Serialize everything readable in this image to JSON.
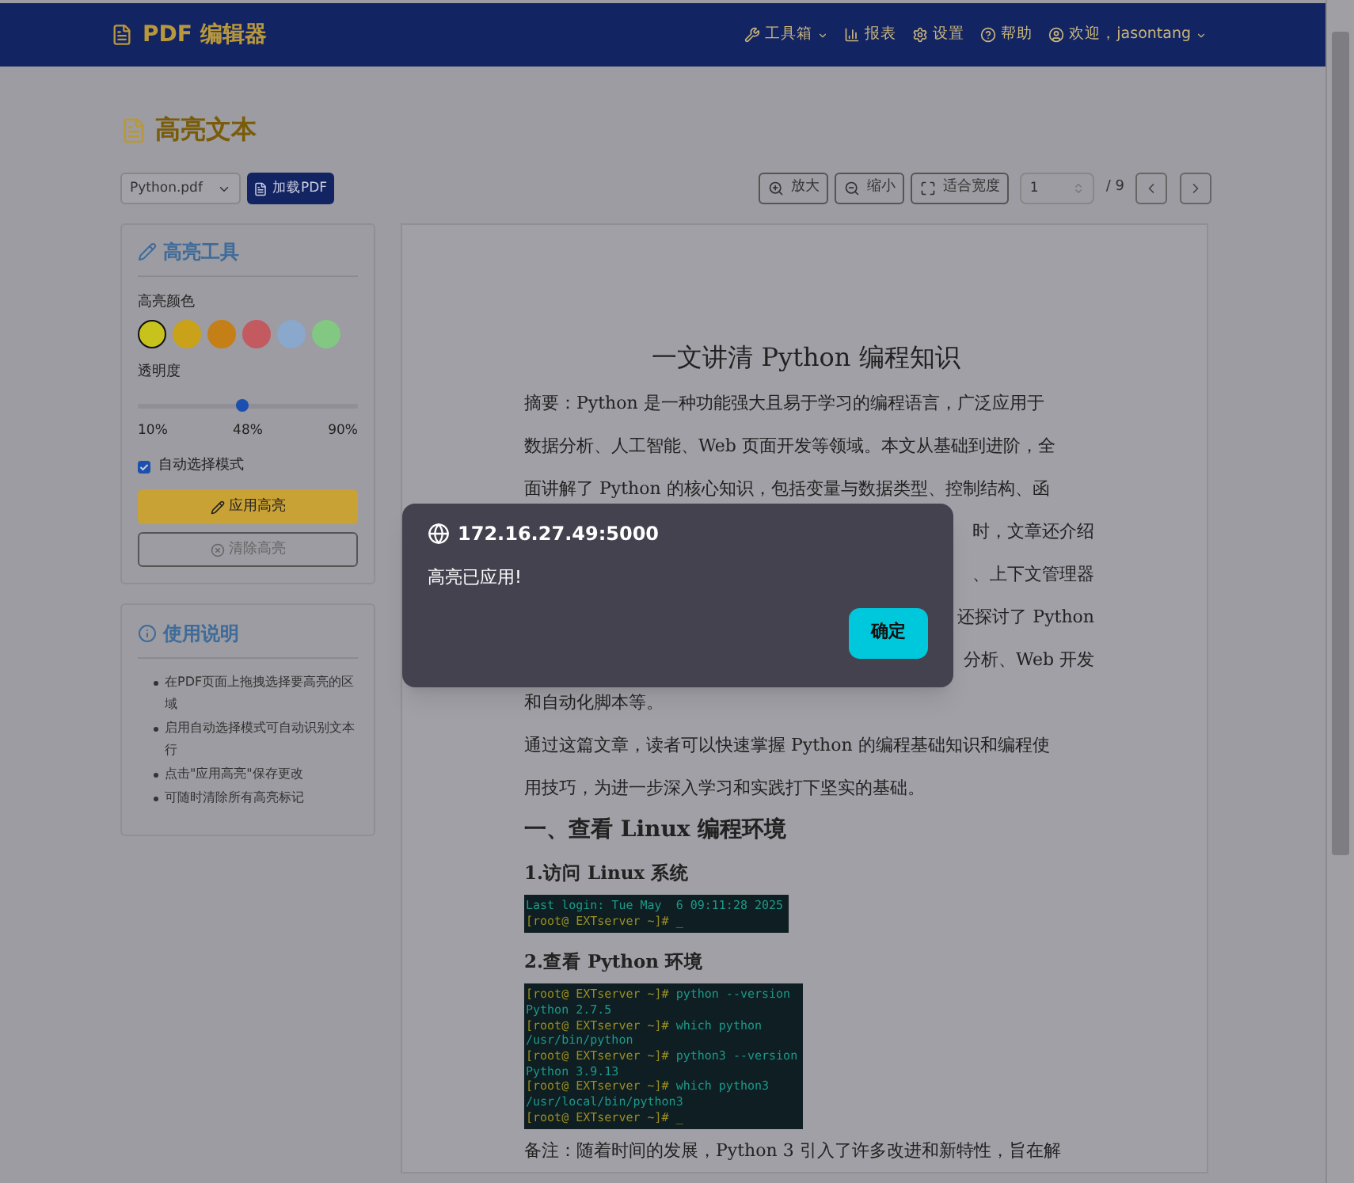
{
  "navbar": {
    "brand": "PDF 编辑器",
    "items": [
      {
        "label": "工具箱",
        "kind": "dropdown"
      },
      {
        "label": "报表",
        "kind": "link"
      },
      {
        "label": "设置",
        "kind": "link"
      },
      {
        "label": "帮助",
        "kind": "link"
      },
      {
        "label": "欢迎，jasontang",
        "kind": "dropdown"
      }
    ]
  },
  "page_title": "高亮文本",
  "toolbar": {
    "file_select": "Python.pdf",
    "load_button": "加载PDF",
    "zoom_in": "放大",
    "zoom_out": "缩小",
    "fit_width": "适合宽度",
    "page_input": "1",
    "page_total": "/ 9"
  },
  "tools_panel": {
    "title": "高亮工具",
    "color_label": "高亮颜色",
    "colors": [
      {
        "color": "#c8c21c",
        "selected": true
      },
      {
        "color": "#c9a219",
        "selected": false
      },
      {
        "color": "#c57f17",
        "selected": false
      },
      {
        "color": "#c25a60",
        "selected": false
      },
      {
        "color": "#8aa7cc",
        "selected": false
      },
      {
        "color": "#82c782",
        "selected": false
      }
    ],
    "opacity_label": "透明度",
    "opacity": {
      "level": 0.475
    },
    "ticks": [
      "10%",
      "48%",
      "90%"
    ],
    "auto_select": {
      "label": "自动选择模式",
      "checked": true
    },
    "apply_button": "应用高亮",
    "clear_button": "清除高亮"
  },
  "help_panel": {
    "title": "使用说明",
    "items": [
      "在PDF页面上拖拽选择要高亮的区域",
      "启用自动选择模式可自动识别文本行",
      "点击\"应用高亮\"保存更改",
      "可随时清除所有高亮标记"
    ]
  },
  "document": {
    "title": "一文讲清 Python 编程知识",
    "abstract_lines": [
      {
        "text": "摘要：Python 是一种功能强大且易于学习的编程语言，广泛应用于",
        "kind": "full"
      },
      {
        "text": "数据分析、人工智能、Web 页面开发等领域。本文从基础到进阶，全",
        "kind": "full"
      },
      {
        "text": "面讲解了 Python 的核心知识，包括变量与数据类型、控制结构、函",
        "kind": "full"
      },
      {
        "text": "时，文章还介绍",
        "kind": "tail"
      },
      {
        "text": "、上下文管理器",
        "kind": "tail"
      },
      {
        "text": "还探讨了 Python",
        "kind": "tail"
      },
      {
        "text": "分析、Web 开发",
        "kind": "tail"
      },
      {
        "text": "和自动化脚本等。",
        "kind": "full"
      }
    ],
    "paragraph_lines": [
      "通过这篇文章，读者可以快速掌握 Python 的编程基础知识和编程使",
      "用技巧，为进一步深入学习和实践打下坚实的基础。"
    ],
    "section_heading": "一、查看 Linux 编程环境",
    "subsections": [
      {
        "heading": "1.访问 Linux 系统",
        "terminal": [
          {
            "text": "Last login: Tue May  6 09:11:28 2025",
            "kind": "output"
          },
          {
            "text": "[root@ EXTserver ~]# _",
            "kind": "prompt"
          }
        ]
      },
      {
        "heading": "2.查看 Python 环境",
        "terminal": [
          {
            "text": "[root@ EXTserver ~]# ",
            "kind": "prompt",
            "command": "python --version"
          },
          {
            "text": "Python 2.7.5",
            "kind": "output"
          },
          {
            "text": "[root@ EXTserver ~]# ",
            "kind": "prompt",
            "command": "which python"
          },
          {
            "text": "/usr/bin/python",
            "kind": "output"
          },
          {
            "text": "[root@ EXTserver ~]# ",
            "kind": "prompt",
            "command": "python3 --version"
          },
          {
            "text": "Python 3.9.13",
            "kind": "output"
          },
          {
            "text": "[root@ EXTserver ~]# ",
            "kind": "prompt",
            "command": "which python3"
          },
          {
            "text": "/usr/local/bin/python3",
            "kind": "output"
          },
          {
            "text": "[root@ EXTserver ~]# _",
            "kind": "prompt"
          }
        ]
      }
    ],
    "note": "备注：随着时间的发展，Python 3 引入了许多改进和新特性，旨在解"
  },
  "dialog": {
    "origin": "172.16.27.49:5000",
    "message": "高亮已应用!",
    "ok_button": "确定"
  }
}
